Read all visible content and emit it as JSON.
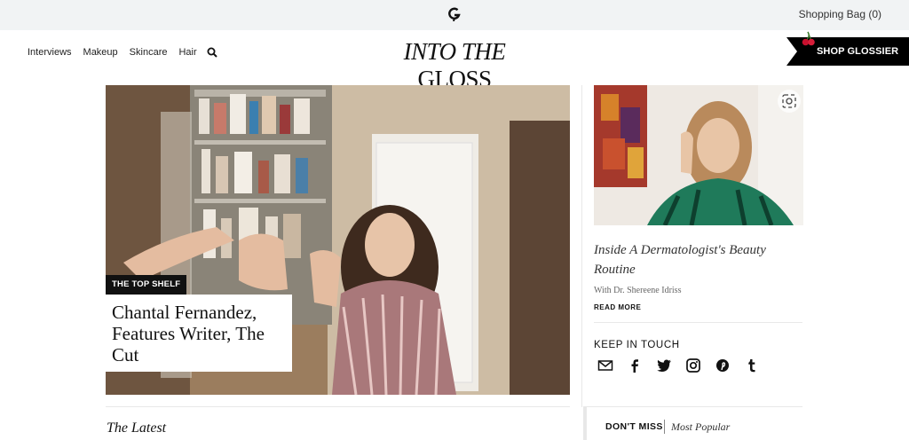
{
  "topbar": {
    "logo_icon": "glossier-g-icon",
    "shopping_bag": "Shopping Bag (0)"
  },
  "nav": {
    "items": [
      "Interviews",
      "Makeup",
      "Skincare",
      "Hair"
    ],
    "search_icon": "search-icon"
  },
  "masthead": {
    "italic": "INTO THE",
    "regular": " GLOSS"
  },
  "shop_button": {
    "label": "SHOP GLOSSIER",
    "icon": "cherry-icon"
  },
  "hero": {
    "tag": "THE TOP SHELF",
    "title": "Chantal Fernandez, Features Writer, The Cut"
  },
  "sidebar": {
    "article_title": "Inside A Dermatologist's Beauty Routine",
    "article_subtitle": "With Dr. Shereene Idriss",
    "read_more": "READ MORE",
    "keep_in_touch": "KEEP IN TOUCH",
    "social_icons": [
      "mail-icon",
      "facebook-icon",
      "twitter-icon",
      "instagram-icon",
      "pinterest-icon",
      "tumblr-icon"
    ]
  },
  "bottom": {
    "latest": "The Latest",
    "dont_miss": "DON'T MISS",
    "most_popular": "Most Popular"
  },
  "colors": {
    "topbar_bg": "#f1f3f4",
    "button_bg": "#000000",
    "cherry": "#c8102e"
  }
}
